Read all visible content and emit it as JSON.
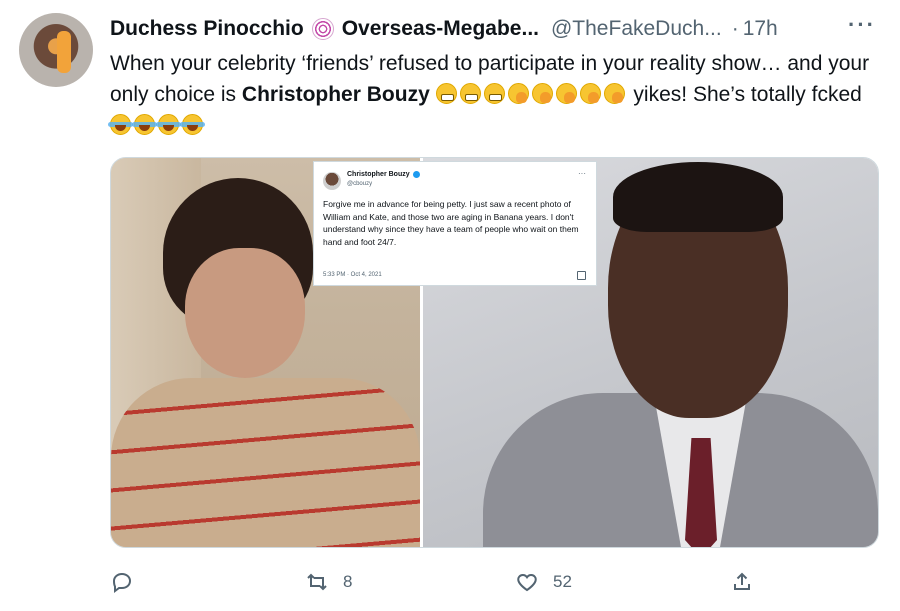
{
  "tweet": {
    "author_name": "Duchess Pinocchio",
    "author_name_icon": "lollipop-icon",
    "author_display_extra": "Overseas-Megabe...",
    "handle": "@TheFakeDuch...",
    "separator": "·",
    "time": "17h",
    "more": "···",
    "text_part1": "When your celebrity ‘friends’ refused to participate in your reality show… and your only choice is ",
    "text_bold": "Christopher Bouzy",
    "text_part2": " yikes! She’s totally fcked",
    "emojis_after_name": [
      "grimacing-face-icon",
      "grimacing-face-icon",
      "grimacing-face-icon",
      "face-with-hand-over-mouth-icon",
      "face-with-hand-over-mouth-icon",
      "face-with-hand-over-mouth-icon",
      "face-with-hand-over-mouth-icon",
      "face-with-hand-over-mouth-icon"
    ],
    "emojis_end": [
      "face-with-tears-of-joy-icon",
      "face-with-tears-of-joy-icon",
      "face-with-tears-of-joy-icon",
      "face-with-tears-of-joy-icon"
    ]
  },
  "embedded_tweet": {
    "name": "Christopher Bouzy",
    "handle": "@cbouzy",
    "more": "···",
    "text": "Forgive me in advance for being petty. I just saw a recent photo of William and Kate, and those two are aging in Banana years. I don't understand why since they have a team of people who wait on them hand and foot 24/7.",
    "timestamp": "5:33 PM · Oct 4, 2021"
  },
  "actions": {
    "replies": "",
    "retweets": "8",
    "likes": "52",
    "share": ""
  },
  "colors": {
    "text": "#0f1419",
    "secondary": "#536471",
    "border": "#cfd9de",
    "verified": "#1d9bf0"
  }
}
